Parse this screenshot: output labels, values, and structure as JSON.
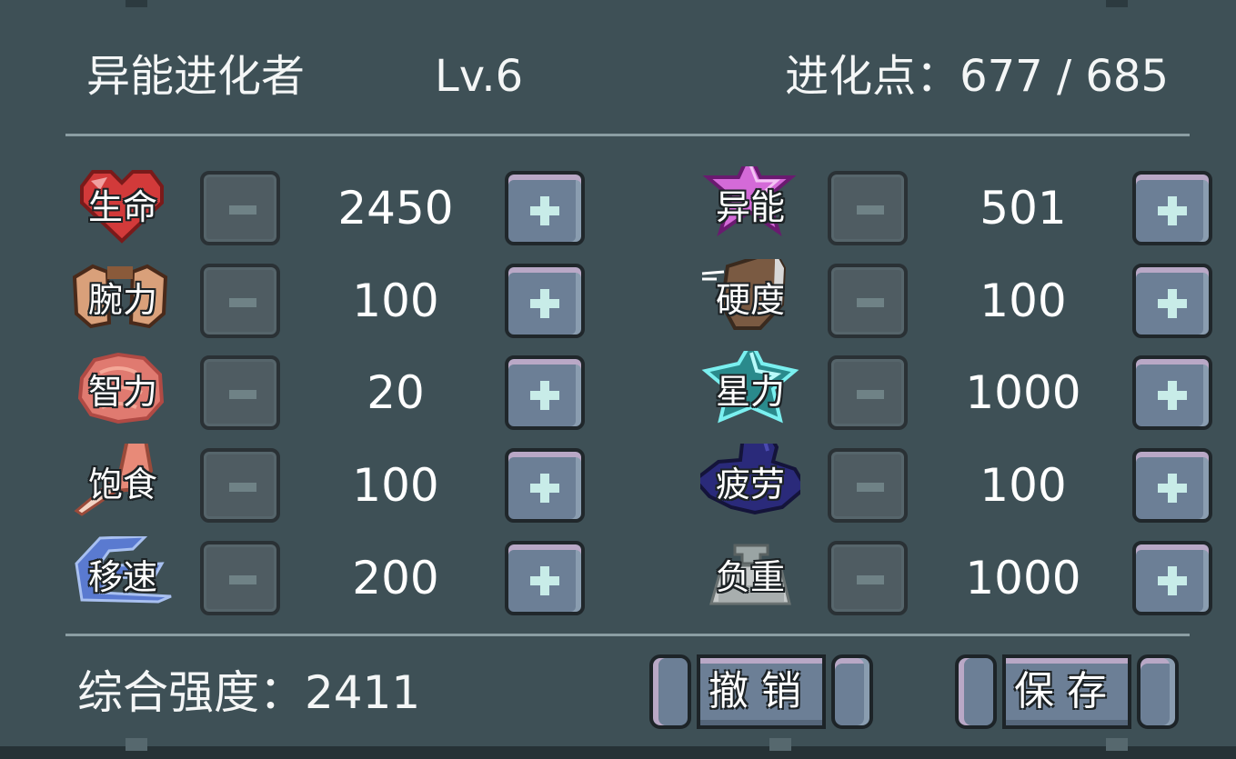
{
  "header": {
    "title": "异能进化者",
    "level": "Lv.6",
    "points": "进化点：677 / 685"
  },
  "left_stats": [
    {
      "label": "生命",
      "value": "2450",
      "icon": "heart-icon"
    },
    {
      "label": "腕力",
      "value": "100",
      "icon": "fists-icon"
    },
    {
      "label": "智力",
      "value": "20",
      "icon": "brain-icon"
    },
    {
      "label": "饱食",
      "value": "100",
      "icon": "drumstick-icon"
    },
    {
      "label": "移速",
      "value": "200",
      "icon": "wind-icon"
    }
  ],
  "right_stats": [
    {
      "label": "异能",
      "value": "501",
      "icon": "psionic-star-icon"
    },
    {
      "label": "硬度",
      "value": "100",
      "icon": "shield-icon"
    },
    {
      "label": "星力",
      "value": "1000",
      "icon": "cyan-star-icon"
    },
    {
      "label": "疲劳",
      "value": "100",
      "icon": "fatigue-cloud-icon"
    },
    {
      "label": "负重",
      "value": "1000",
      "icon": "weight-icon"
    }
  ],
  "footer": {
    "strength": "综合强度：2411",
    "cancel_label": "撤销",
    "save_label": "保存"
  },
  "colors": {
    "panel_bg": "#3e5056",
    "text": "#f4f6f6",
    "plus_button": "#6c7f96",
    "minus_button": "#4f5c62"
  }
}
